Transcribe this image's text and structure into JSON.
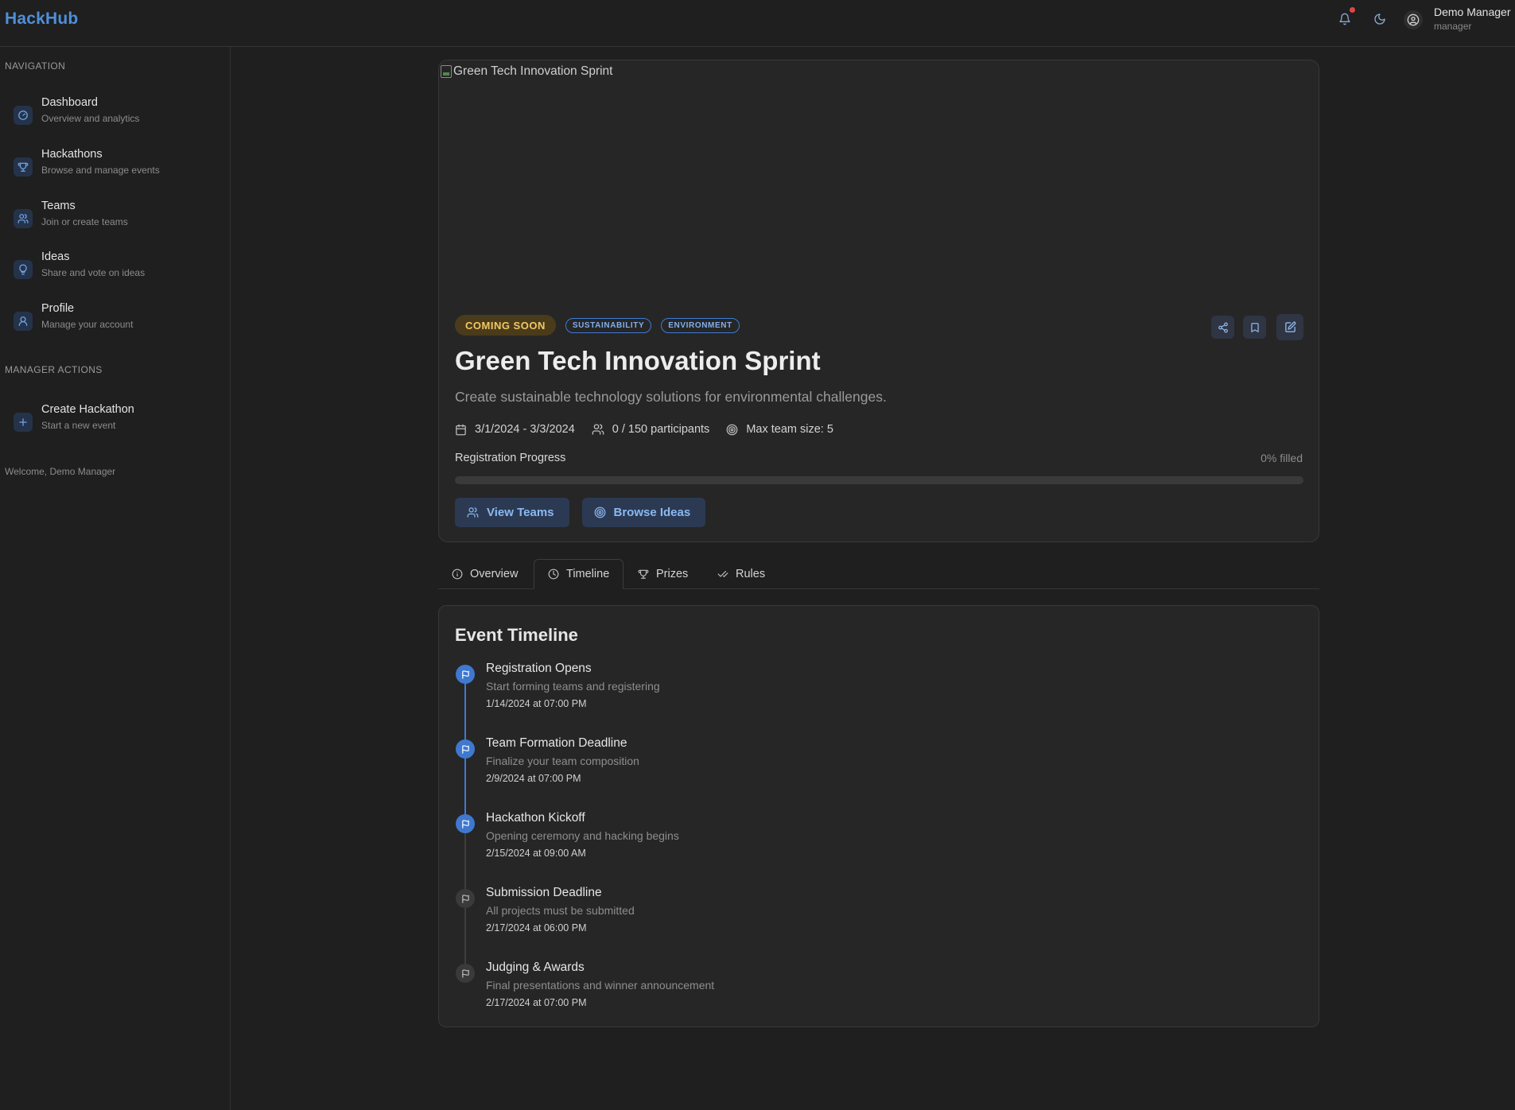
{
  "app": {
    "brand": "HackHub"
  },
  "header": {
    "user_name": "Demo Manager",
    "user_role": "manager"
  },
  "sidebar": {
    "navigation_heading": "NAVIGATION",
    "items": [
      {
        "label": "Dashboard",
        "sub": "Overview and analytics",
        "icon": "dashboard-icon"
      },
      {
        "label": "Hackathons",
        "sub": "Browse and manage events",
        "icon": "trophy-icon"
      },
      {
        "label": "Teams",
        "sub": "Join or create teams",
        "icon": "users-icon"
      },
      {
        "label": "Ideas",
        "sub": "Share and vote on ideas",
        "icon": "lightbulb-icon"
      },
      {
        "label": "Profile",
        "sub": "Manage your account",
        "icon": "user-icon"
      }
    ],
    "manager_heading": "MANAGER ACTIONS",
    "manager_items": [
      {
        "label": "Create Hackathon",
        "sub": "Start a new event",
        "icon": "plus-icon"
      }
    ],
    "welcome": "Welcome, Demo Manager"
  },
  "event": {
    "image_alt": "Green Tech Innovation Sprint",
    "status": "COMING SOON",
    "tags": [
      "SUSTAINABILITY",
      "ENVIRONMENT"
    ],
    "title": "Green Tech Innovation Sprint",
    "description": "Create sustainable technology solutions for environmental challenges.",
    "dates": "3/1/2024 - 3/3/2024",
    "participants": "0 / 150 participants",
    "max_team": "Max team size: 5",
    "registration_label": "Registration Progress",
    "registration_pct_text": "0% filled",
    "registration_fill": 0,
    "buttons": {
      "view_teams": "View Teams",
      "browse_ideas": "Browse Ideas"
    }
  },
  "tabs": [
    {
      "label": "Overview",
      "icon": "info-icon"
    },
    {
      "label": "Timeline",
      "icon": "clock-icon",
      "active": true
    },
    {
      "label": "Prizes",
      "icon": "trophy-icon"
    },
    {
      "label": "Rules",
      "icon": "check-check-icon"
    }
  ],
  "timeline": {
    "title": "Event Timeline",
    "items": [
      {
        "name": "Registration Opens",
        "desc": "Start forming teams and registering",
        "date": "1/14/2024 at 07:00 PM",
        "done": true
      },
      {
        "name": "Team Formation Deadline",
        "desc": "Finalize your team composition",
        "date": "2/9/2024 at 07:00 PM",
        "done": true
      },
      {
        "name": "Hackathon Kickoff",
        "desc": "Opening ceremony and hacking begins",
        "date": "2/15/2024 at 09:00 AM",
        "done": true
      },
      {
        "name": "Submission Deadline",
        "desc": "All projects must be submitted",
        "date": "2/17/2024 at 06:00 PM",
        "done": false
      },
      {
        "name": "Judging & Awards",
        "desc": "Final presentations and winner announcement",
        "date": "2/17/2024 at 07:00 PM",
        "done": false
      }
    ]
  },
  "colors": {
    "accent": "#4f8fd9",
    "background": "#1f1f1f",
    "card": "#262626",
    "status_soon": "#f1c865",
    "notification": "#e04646"
  }
}
